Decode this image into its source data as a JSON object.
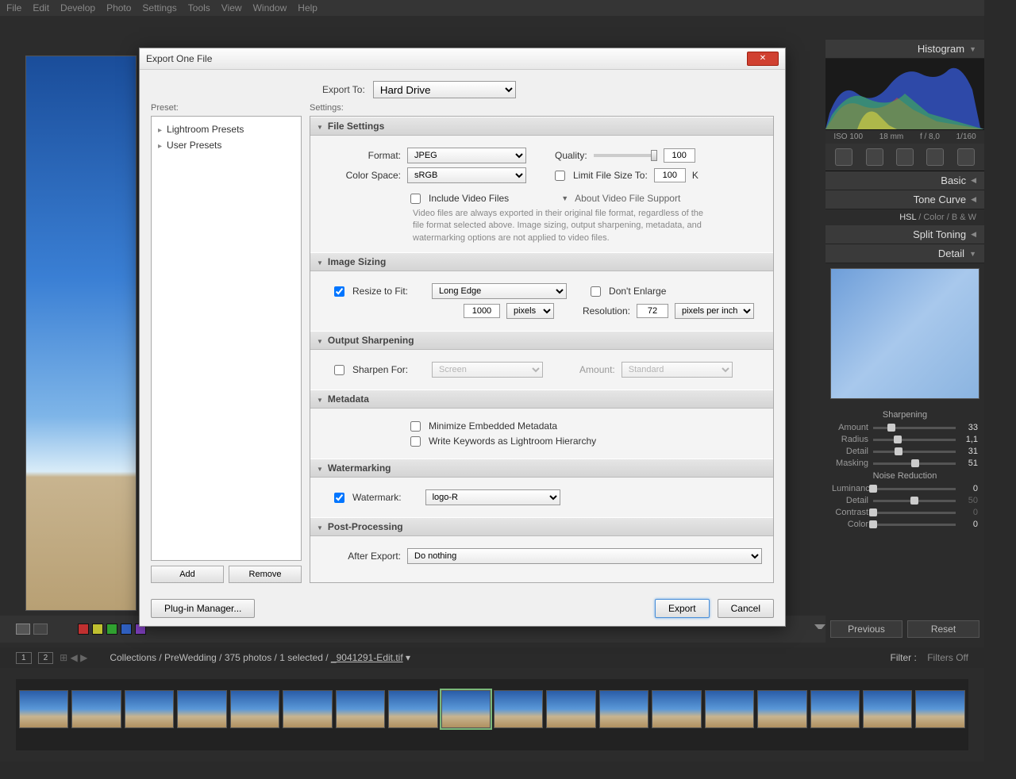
{
  "menubar": [
    "File",
    "Edit",
    "Develop",
    "Photo",
    "Settings",
    "Tools",
    "View",
    "Window",
    "Help"
  ],
  "dialog": {
    "title": "Export One File",
    "export_to_label": "Export To:",
    "export_to_value": "Hard Drive",
    "preset_label": "Preset:",
    "settings_label": "Settings:",
    "presets": [
      "Lightroom Presets",
      "User Presets"
    ],
    "add_btn": "Add",
    "remove_btn": "Remove",
    "plugin_btn": "Plug-in Manager...",
    "export_btn": "Export",
    "cancel_btn": "Cancel",
    "sections": {
      "file_settings": {
        "title": "File Settings",
        "format_label": "Format:",
        "format_value": "JPEG",
        "quality_label": "Quality:",
        "quality_value": "100",
        "colorspace_label": "Color Space:",
        "colorspace_value": "sRGB",
        "limit_label": "Limit File Size To:",
        "limit_value": "100",
        "limit_unit": "K",
        "include_video": "Include Video Files",
        "about_video": "About Video File Support",
        "video_note": "Video files are always exported in their original file format, regardless of the file format selected above. Image sizing, output sharpening, metadata, and watermarking options are not applied to video files."
      },
      "image_sizing": {
        "title": "Image Sizing",
        "resize_label": "Resize to Fit:",
        "resize_value": "Long Edge",
        "dont_enlarge": "Don't Enlarge",
        "size_value": "1000",
        "size_unit": "pixels",
        "resolution_label": "Resolution:",
        "resolution_value": "72",
        "resolution_unit": "pixels per inch"
      },
      "output_sharpening": {
        "title": "Output Sharpening",
        "sharpen_label": "Sharpen For:",
        "sharpen_value": "Screen",
        "amount_label": "Amount:",
        "amount_value": "Standard"
      },
      "metadata": {
        "title": "Metadata",
        "minimize": "Minimize Embedded Metadata",
        "keywords": "Write Keywords as Lightroom Hierarchy"
      },
      "watermarking": {
        "title": "Watermarking",
        "watermark_label": "Watermark:",
        "watermark_value": "logo-R"
      },
      "post": {
        "title": "Post-Processing",
        "after_label": "After Export:",
        "after_value": "Do nothing"
      }
    }
  },
  "right_panel": {
    "histogram_title": "Histogram",
    "exposure_info": {
      "iso": "ISO 100",
      "focal": "18 mm",
      "aperture": "f / 8,0",
      "shutter": "1/160"
    },
    "basic_title": "Basic",
    "tone_title": "Tone Curve",
    "hsl_tabs": {
      "hsl": "HSL",
      "color": "Color",
      "bw": "B & W"
    },
    "split_title": "Split Toning",
    "detail_title": "Detail",
    "sharpening": {
      "title": "Sharpening",
      "amount": {
        "label": "Amount",
        "value": "33"
      },
      "radius": {
        "label": "Radius",
        "value": "1,1"
      },
      "detail": {
        "label": "Detail",
        "value": "31"
      },
      "masking": {
        "label": "Masking",
        "value": "51"
      }
    },
    "noise": {
      "title": "Noise Reduction",
      "luminance": {
        "label": "Luminance",
        "value": "0"
      },
      "detail": {
        "label": "Detail",
        "value": "50"
      },
      "contrast": {
        "label": "Contrast",
        "value": "0"
      },
      "color": {
        "label": "Color",
        "value": "0"
      }
    }
  },
  "bottom": {
    "previous": "Previous",
    "reset": "Reset",
    "nums": [
      "1",
      "2"
    ],
    "breadcrumb": "Collections / PreWedding / 375 photos / 1 selected / ",
    "filename": "_9041291-Edit.tif",
    "filter_label": "Filter :",
    "filter_value": "Filters Off"
  }
}
